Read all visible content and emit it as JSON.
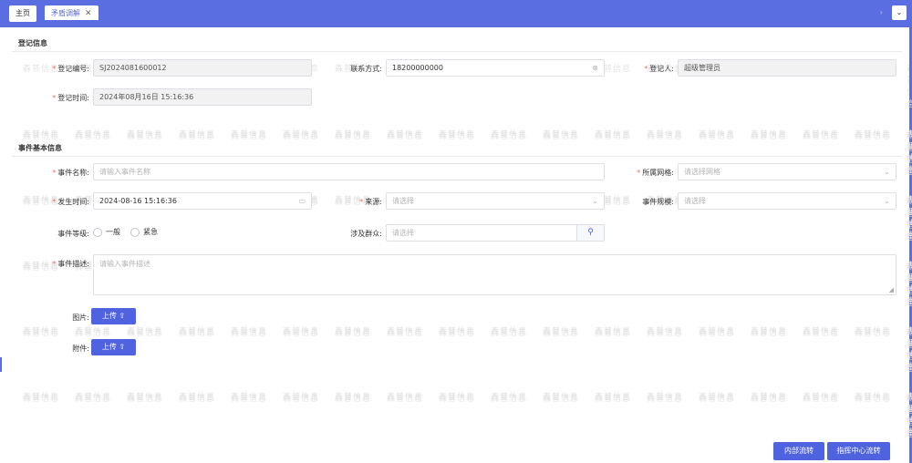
{
  "tabs": [
    {
      "label": "主页"
    },
    {
      "label": "矛盾调解",
      "close": "✕"
    }
  ],
  "top": {
    "arrow": "›",
    "dropdown": "⌄"
  },
  "watermark": "森普信息",
  "sections": {
    "register": "登记信息",
    "event": "事件基本信息"
  },
  "register": {
    "code_label": "登记编号:",
    "code_value": "SJ2024081600012",
    "phone_label": "联系方式:",
    "phone_value": "18200000000",
    "registrar_label": "登记人:",
    "registrar_value": "超级管理员",
    "time_label": "登记时间:",
    "time_value": "2024年08月16日 15:16:36"
  },
  "event": {
    "name_label": "事件名称:",
    "name_placeholder": "请输入事件名称",
    "grid_label": "所属网格:",
    "grid_placeholder": "请选择网格",
    "occur_label": "发生时间:",
    "occur_value": "2024-08-16 15:16:36",
    "source_label": "来源:",
    "source_placeholder": "请选择",
    "scale_label": "事件规模:",
    "scale_placeholder": "请选择",
    "level_label": "事件等级:",
    "level_options": [
      "一般",
      "紧急"
    ],
    "people_label": "涉及群众:",
    "people_placeholder": "请选择",
    "desc_label": "事件描述:",
    "desc_placeholder": "请输入事件描述",
    "image_label": "图片:",
    "attach_label": "附件:",
    "upload_label": "上传",
    "upload_icon": "⇧"
  },
  "footer": {
    "internal_button": "内部流转",
    "command_button": "指挥中心流转"
  },
  "colors": {
    "accent": "#5b6ee1",
    "button": "#4f62e0",
    "required": "#f56c6c"
  }
}
